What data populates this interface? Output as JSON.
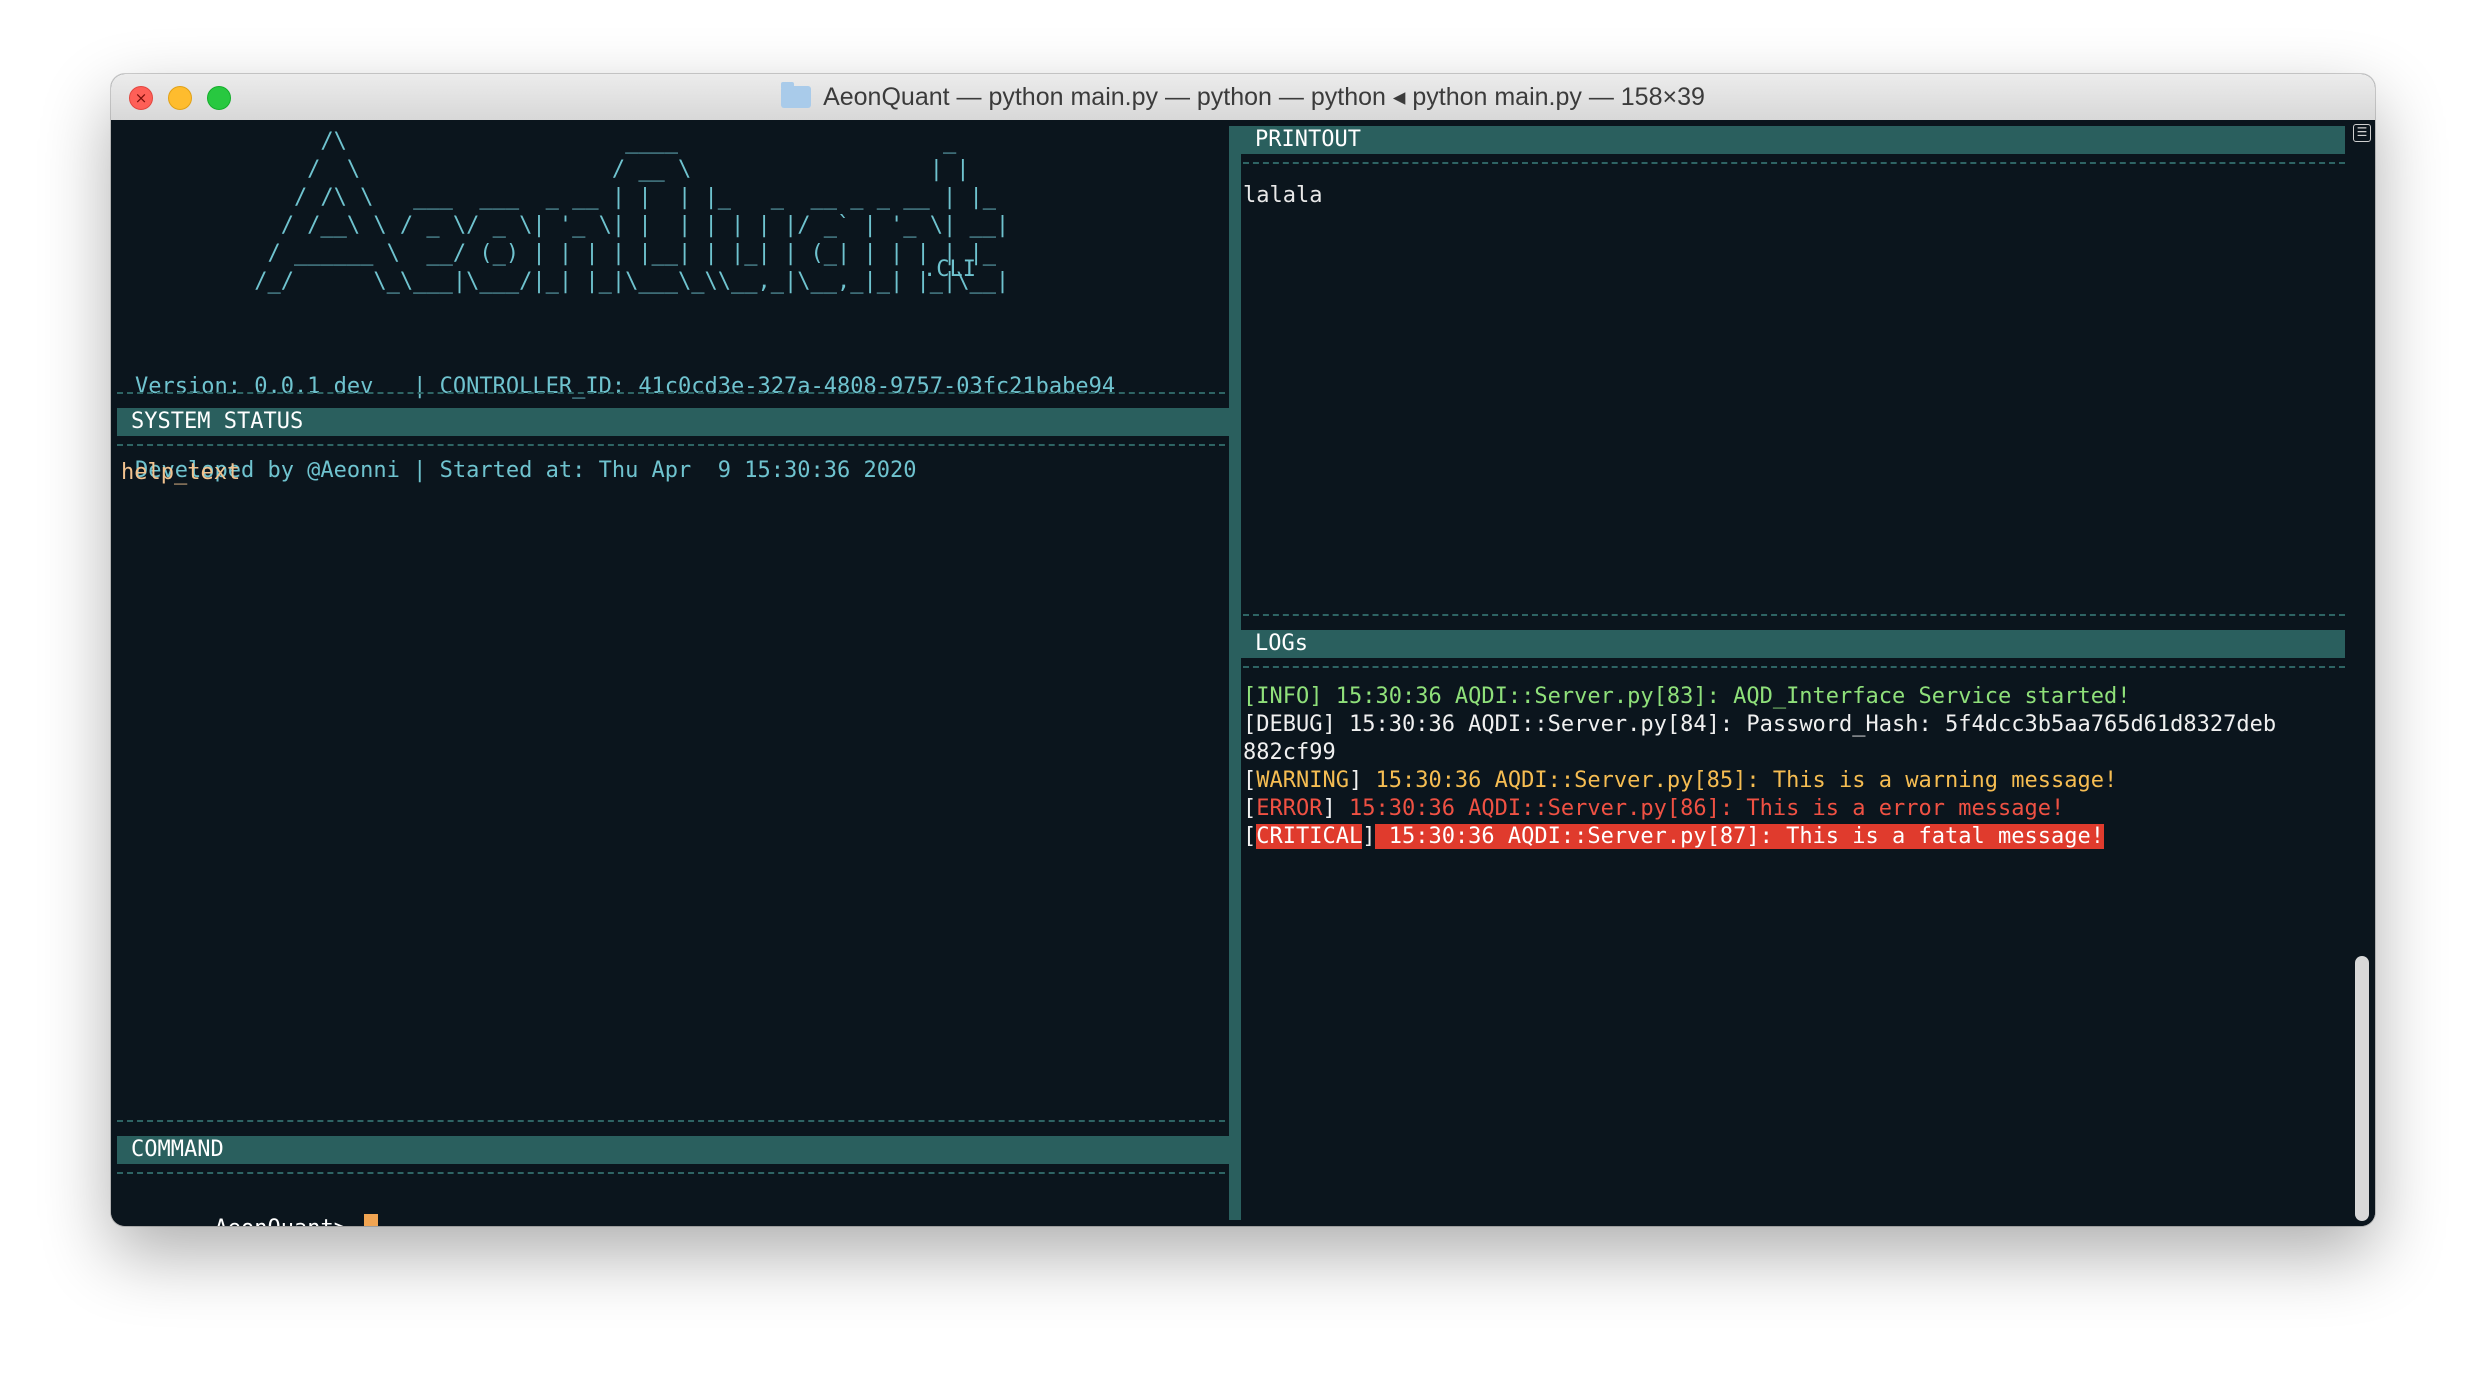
{
  "window": {
    "title": "AeonQuant — python main.py — python — python ◂ python main.py — 158×39"
  },
  "banner": {
    "ascii": "              /\\                     ____                    _\n             /  \\                   / __ \\                  | |\n            / /\\ \\   ___  ___  _ __ | |  | |_   _  __ _ _ __ | |_\n           / /__\\ \\ / _ \\/ _ \\| '_ \\| |  | | | | |/ _` | '_ \\| __|\n          / ______ \\  __/ (_) | | | | |__| | |_| | (_| | | | | |_\n         /_/      \\_\\___|\\___/|_| |_|\\___\\_\\\\__,_|\\__,_|_| |_|\\__|",
    "suffix": ".CLI",
    "version_line": "Version: 0.0.1 dev   | CONTROLLER_ID: 41c0cd3e-327a-4808-9757-03fc21babe94",
    "developer_line": "Developed by @Aeonni | Started at: Thu Apr  9 15:30:36 2020"
  },
  "panels": {
    "system_status": {
      "title": "SYSTEM STATUS",
      "body": "help_text"
    },
    "command": {
      "title": "COMMAND",
      "prompt": "AeonQuant> "
    },
    "printout": {
      "title": "PRINTOUT",
      "body": "lalala"
    },
    "logs": {
      "title": "LOGs",
      "entries": [
        {
          "level": "INFO",
          "text": " 15:30:36 AQDI::Server.py[83]: AQD_Interface Service started!"
        },
        {
          "level": "DEBUG",
          "text": " 15:30:36 AQDI::Server.py[84]: Password_Hash: 5f4dcc3b5aa765d61d8327deb",
          "wrap": "882cf99"
        },
        {
          "level": "WARNING",
          "text": " 15:30:36 AQDI::Server.py[85]: This is a warning message!"
        },
        {
          "level": "ERROR",
          "text": " 15:30:36 AQDI::Server.py[86]: This is a error message!"
        },
        {
          "level": "CRITICAL",
          "text": " 15:30:36 AQDI::Server.py[87]: This is a fatal message!"
        }
      ]
    }
  },
  "colors": {
    "background": "#0b151d",
    "header": "#2a5f5e",
    "accent_text": "#6fc3cf",
    "info": "#8fe07a",
    "warning": "#f6bd52",
    "error": "#ef5143",
    "critical_bg": "#e03b2d",
    "cursor": "#f0a452"
  },
  "icons": [
    "close-icon",
    "minimize-icon",
    "maximize-icon",
    "folder-icon",
    "split-pane-icon"
  ]
}
